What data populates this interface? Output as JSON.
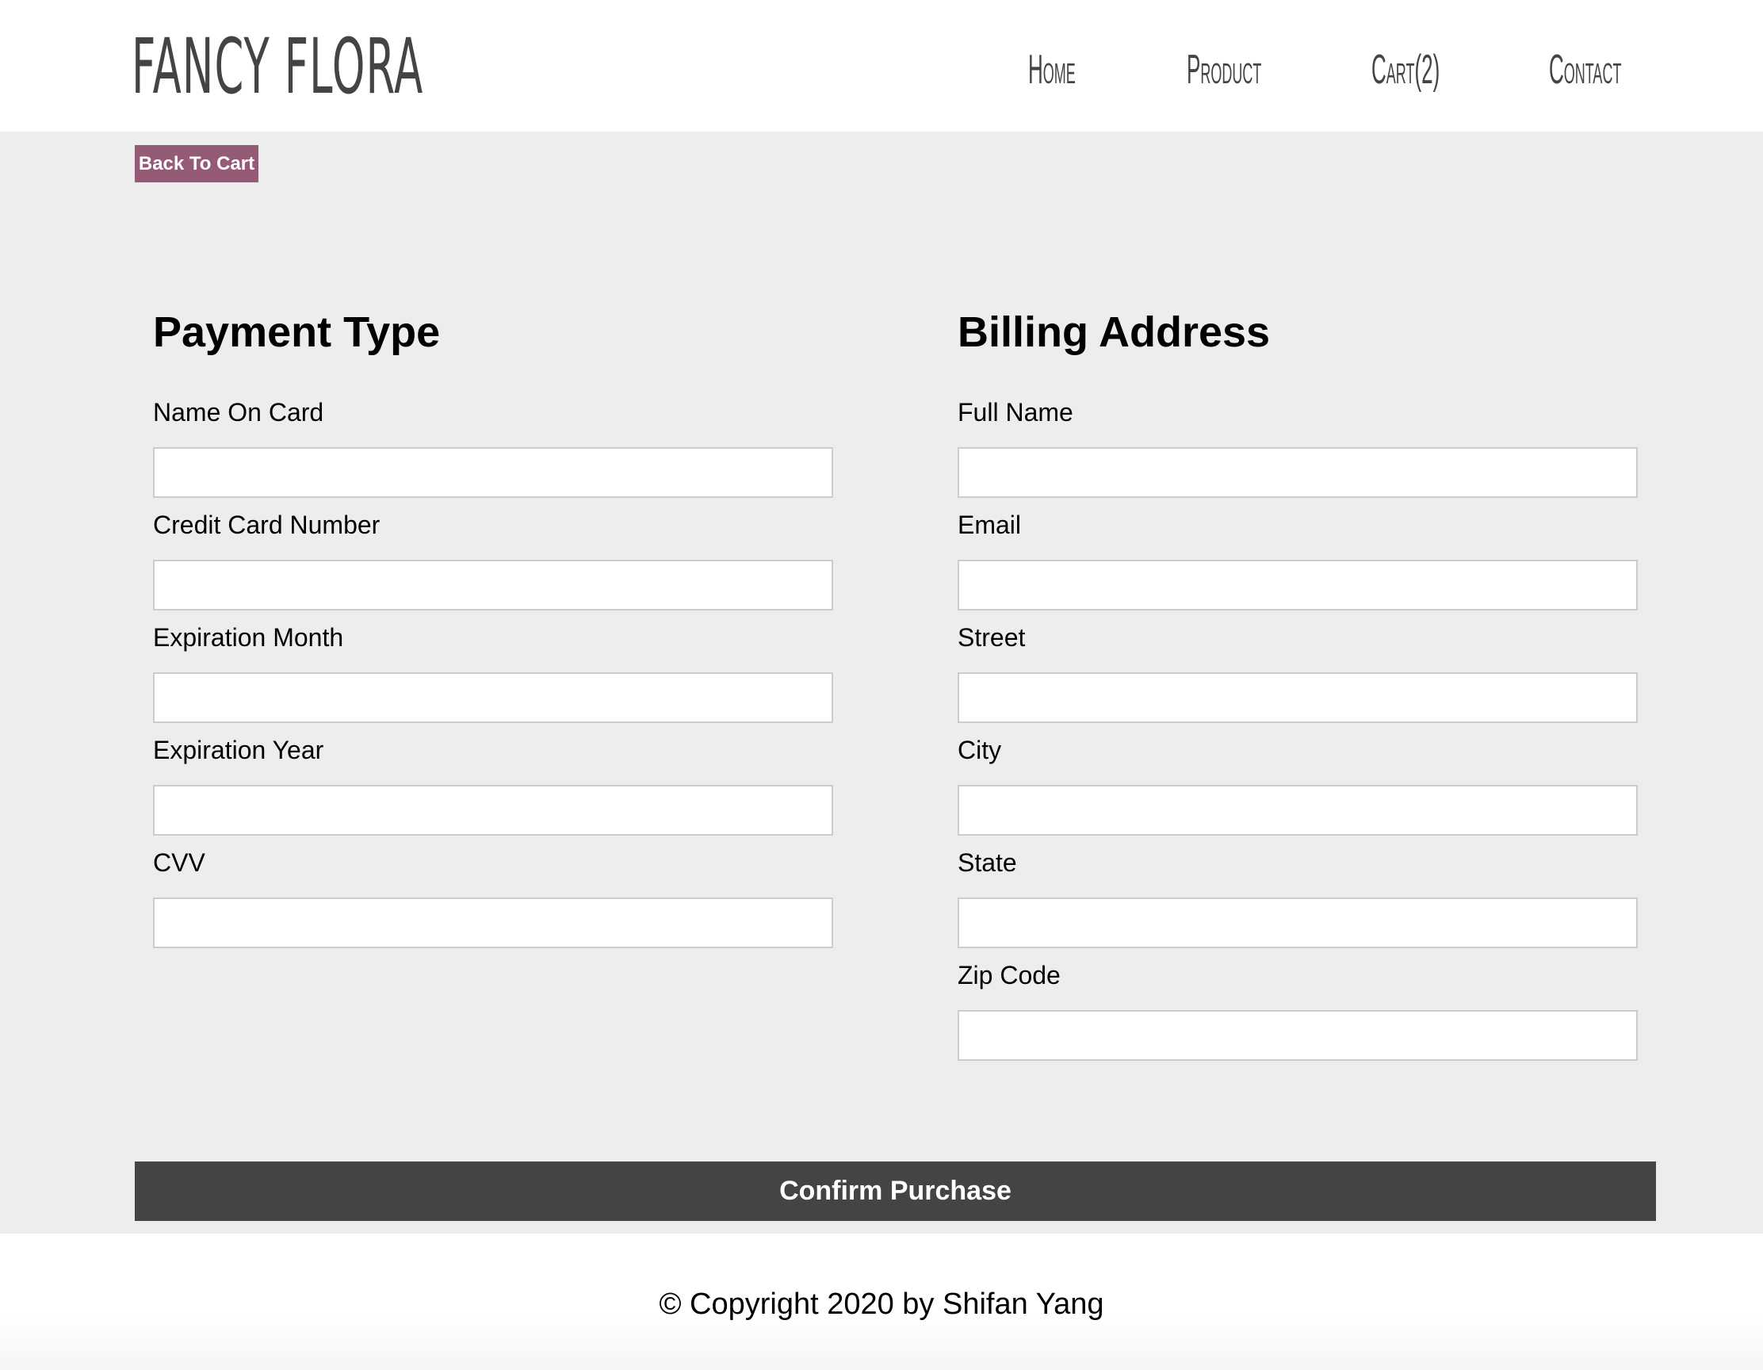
{
  "header": {
    "logo": "FANCY FLORA",
    "nav": [
      "Home",
      "Product",
      "Cart(2)",
      "Contact"
    ]
  },
  "back_button": "Back To Cart",
  "payment": {
    "title": "Payment Type",
    "fields": [
      {
        "label": "Name On Card",
        "value": ""
      },
      {
        "label": "Credit Card Number",
        "value": ""
      },
      {
        "label": "Expiration Month",
        "value": ""
      },
      {
        "label": "Expiration Year",
        "value": ""
      },
      {
        "label": "CVV",
        "value": ""
      }
    ]
  },
  "billing": {
    "title": "Billing Address",
    "fields": [
      {
        "label": "Full Name",
        "value": ""
      },
      {
        "label": "Email",
        "value": ""
      },
      {
        "label": "Street",
        "value": ""
      },
      {
        "label": "City",
        "value": ""
      },
      {
        "label": "State",
        "value": ""
      },
      {
        "label": "Zip Code",
        "value": ""
      }
    ]
  },
  "confirm_button": "Confirm Purchase",
  "footer": {
    "copyright": "© Copyright 2020 by Shifan Yang"
  },
  "colors": {
    "accent": "#955a75",
    "button": "#444444",
    "background": "#ededed"
  }
}
